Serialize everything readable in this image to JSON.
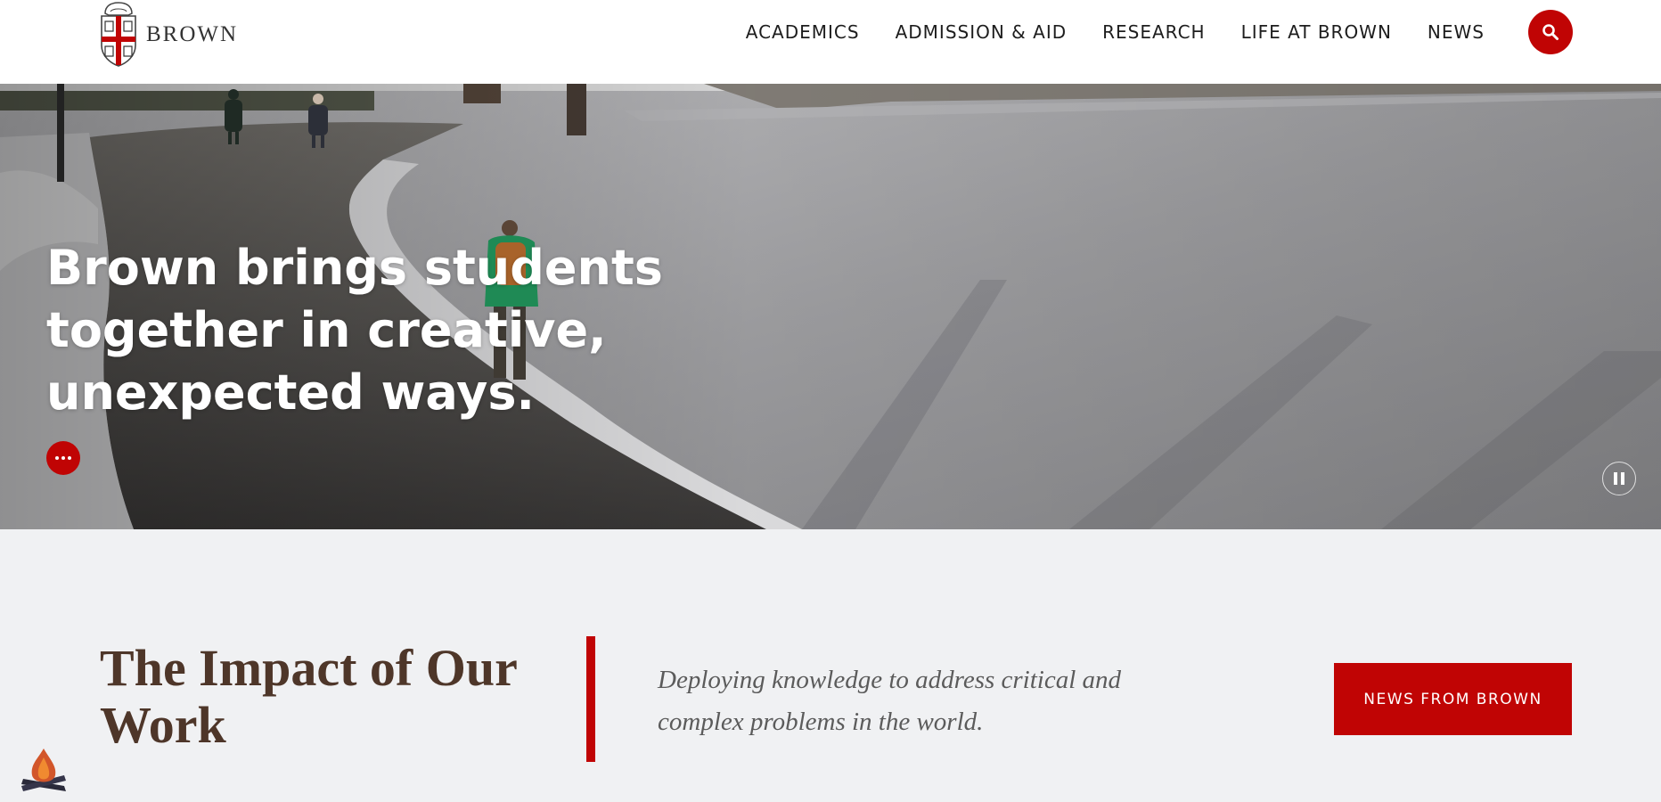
{
  "header": {
    "logo_text": "BROWN",
    "nav": [
      {
        "label": "ACADEMICS"
      },
      {
        "label": "ADMISSION & AID"
      },
      {
        "label": "RESEARCH"
      },
      {
        "label": "LIFE AT BROWN"
      },
      {
        "label": "NEWS"
      }
    ],
    "search_icon": "search-icon"
  },
  "hero": {
    "headline": "Brown brings students together in creative, unexpected ways.",
    "more_icon": "ellipsis-icon",
    "pause_icon": "pause-icon"
  },
  "impact": {
    "title": "The Impact of Our Work",
    "subtitle": "Deploying knowledge to address critical and complex problems in the world.",
    "button_label": "NEWS FROM BROWN"
  },
  "colors": {
    "brand_red": "#c00404",
    "brown_text": "#4e3629",
    "section_bg": "#f0f1f3"
  },
  "floating_icon": "campfire-icon"
}
